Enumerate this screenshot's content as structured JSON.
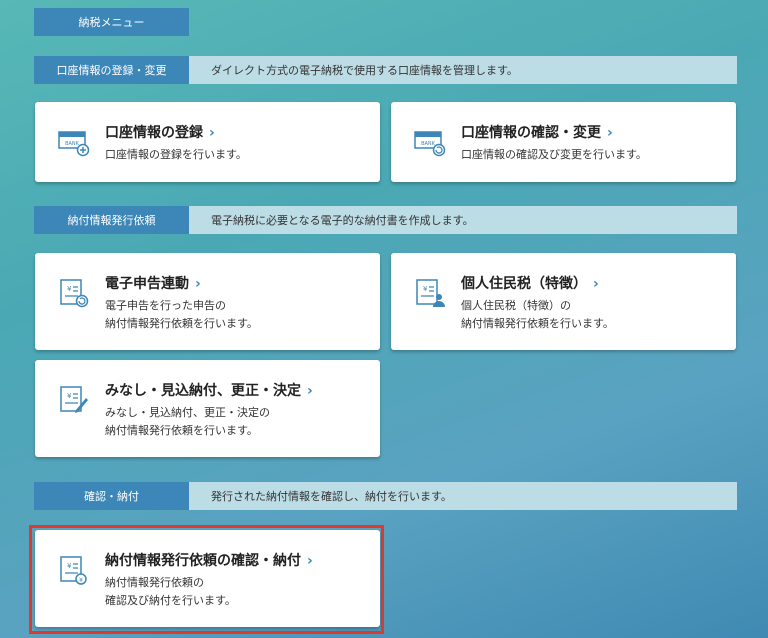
{
  "menu_tab": "納税メニュー",
  "sections": [
    {
      "tag": "口座情報の登録・変更",
      "desc": "ダイレクト方式の電子納税で使用する口座情報を管理します。",
      "cards": [
        {
          "title": "口座情報の登録",
          "sub": "口座情報の登録を行います。",
          "icon": "bank-add-icon"
        },
        {
          "title": "口座情報の確認・変更",
          "sub": "口座情報の確認及び変更を行います。",
          "icon": "bank-refresh-icon"
        }
      ]
    },
    {
      "tag": "納付情報発行依頼",
      "desc": "電子納税に必要となる電子的な納付書を作成します。",
      "cards": [
        {
          "title": "電子申告連動",
          "sub": "電子申告を行った申告の\n納付情報発行依頼を行います。",
          "icon": "yen-doc-refresh-icon"
        },
        {
          "title": "個人住民税（特徴）",
          "sub": "個人住民税（特徴）の\n納付情報発行依頼を行います。",
          "icon": "yen-doc-person-icon"
        },
        {
          "title": "みなし・見込納付、更正・決定",
          "sub": "みなし・見込納付、更正・決定の\n納付情報発行依頼を行います。",
          "icon": "yen-doc-pen-icon"
        }
      ]
    },
    {
      "tag": "確認・納付",
      "desc": "発行された納付情報を確認し、納付を行います。",
      "cards": [
        {
          "title": "納付情報発行依頼の確認・納付",
          "sub": "納付情報発行依頼の\n確認及び納付を行います。",
          "icon": "yen-doc-coin-icon"
        }
      ]
    }
  ],
  "chevron": "›",
  "colors": {
    "accent": "#3c86b8",
    "highlight": "#e2392b"
  }
}
